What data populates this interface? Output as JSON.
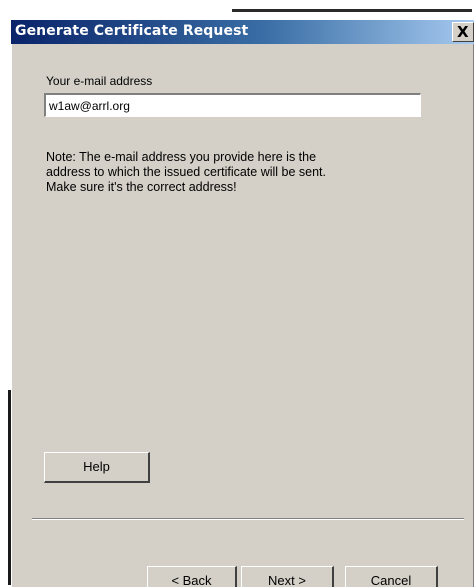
{
  "window": {
    "title": "Generate Certificate Request",
    "close_glyph": "X",
    "close_icon": "close-icon"
  },
  "form": {
    "email_label": "Your e-mail address",
    "email_value": "w1aw@arrl.org",
    "note_lines": [
      "Note: The e-mail address you provide here is the",
      "address to which the issued certificate will be sent.",
      "Make sure it's the correct address!"
    ]
  },
  "buttons": {
    "help": "Help",
    "back": "< Back",
    "next": "Next >",
    "cancel": "Cancel"
  },
  "colors": {
    "titlebar_start": "#0a246a",
    "titlebar_end": "#a6caf0",
    "dialog_face": "#d4d0c8"
  }
}
